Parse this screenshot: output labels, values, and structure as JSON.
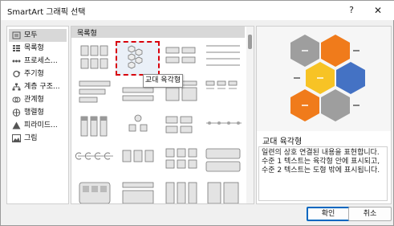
{
  "window": {
    "title": "SmartArt 그래픽 선택",
    "help": "?",
    "close": "✕"
  },
  "categories": [
    {
      "label": "모두",
      "icon": "all-icon",
      "selected": true
    },
    {
      "label": "목록형",
      "icon": "list-icon"
    },
    {
      "label": "프로세스...",
      "icon": "process-icon"
    },
    {
      "label": "주기형",
      "icon": "cycle-icon"
    },
    {
      "label": "계층 구조...",
      "icon": "hierarchy-icon"
    },
    {
      "label": "관계형",
      "icon": "relationship-icon"
    },
    {
      "label": "행렬형",
      "icon": "matrix-icon"
    },
    {
      "label": "피라미드...",
      "icon": "pyramid-icon"
    },
    {
      "label": "그림",
      "icon": "picture-icon"
    }
  ],
  "gallery": {
    "section": "목록형",
    "tooltip": "교대 육각형",
    "selected_tile": 1
  },
  "preview": {
    "name": "교대 육각형",
    "description": [
      "일련의 상호 연결된 내용을 표현합니다.",
      "수준 1 텍스트는 육각형 안에 표시되고,",
      "수준 2 텍스트는 도형 밖에 표시됩니다."
    ],
    "colors": {
      "gray": "#9e9e9e",
      "orange": "#f07b1b",
      "yellow": "#f7c325",
      "blue": "#4472c4"
    }
  },
  "buttons": {
    "ok": "확인",
    "cancel": "취소"
  },
  "colors": {
    "selection": "#d8000c",
    "accent": "#0067c0"
  }
}
